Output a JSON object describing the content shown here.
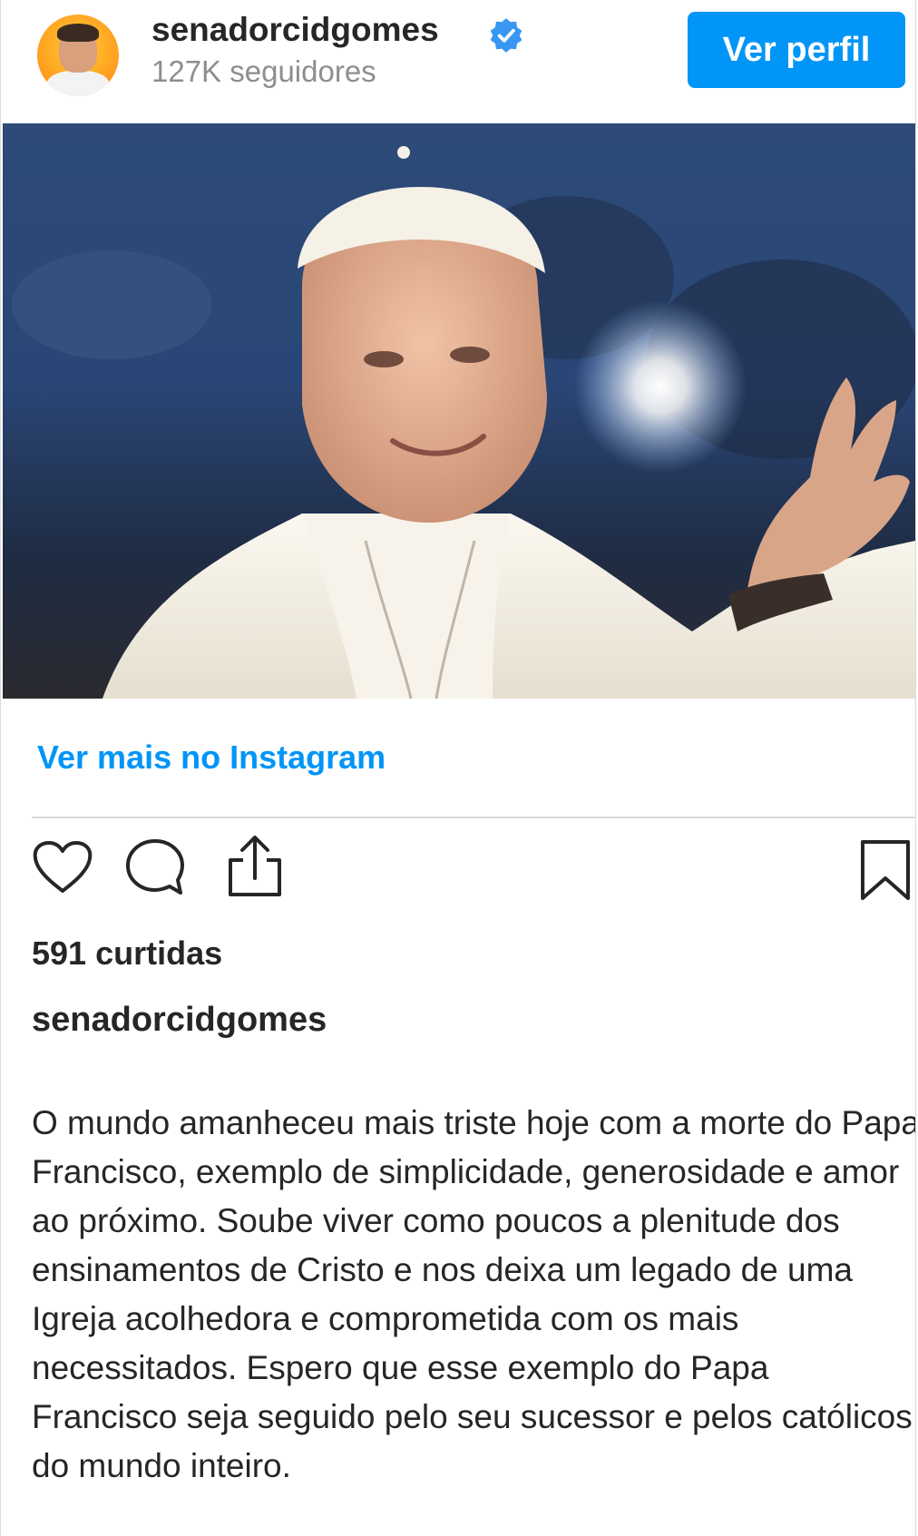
{
  "header": {
    "username": "senadorcidgomes",
    "followers": "127K seguidores",
    "view_profile_label": "Ver perfil",
    "avatar_icon": "profile-photo",
    "verified_icon": "verified-badge-icon"
  },
  "post": {
    "image_description_icon": "post-photo",
    "more_link": "Ver mais no Instagram"
  },
  "actions": {
    "like_icon": "heart-icon",
    "comment_icon": "comment-icon",
    "share_icon": "share-icon",
    "save_icon": "bookmark-icon"
  },
  "stats": {
    "likes": "591 curtidas"
  },
  "caption": {
    "username": "senadorcidgomes",
    "text": "O mundo amanheceu mais triste hoje com a morte do Papa Francisco, exemplo de simplicidade, generosidade e amor ao próximo. Soube viver como poucos a plenitude dos ensinamentos de Cristo e nos deixa um legado de uma Igreja acolhedora e comprometida com os mais necessitados. Espero que esse exemplo do Papa Francisco seja seguido pelo seu sucessor e pelos católicos do mundo inteiro."
  },
  "colors": {
    "accent": "#0095f6",
    "text": "#262626",
    "secondary_text": "#8e8e8e",
    "border": "#dbdbdb"
  }
}
